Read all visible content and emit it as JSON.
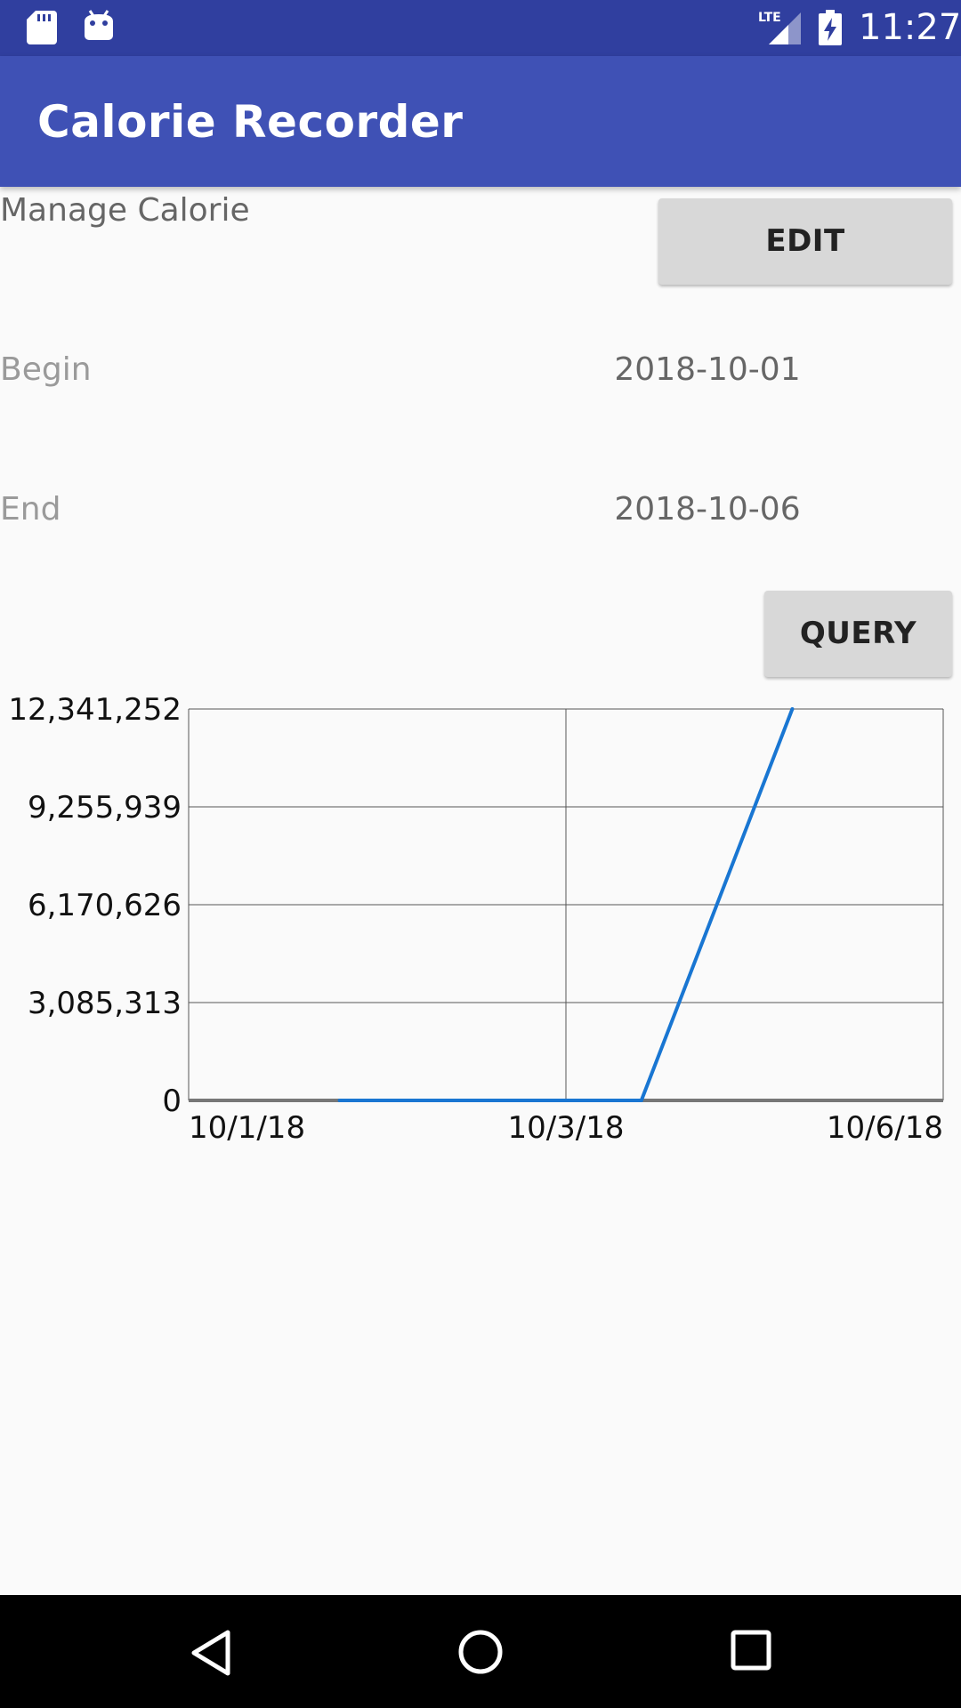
{
  "status_bar": {
    "time": "11:27",
    "network": "LTE",
    "icons": [
      "sd-card-icon",
      "android-icon",
      "lte-signal-icon",
      "battery-charging-icon"
    ]
  },
  "app_bar": {
    "title": "Calorie Recorder"
  },
  "manage": {
    "title": "Manage Calorie",
    "edit_label": "EDIT"
  },
  "filter": {
    "begin_label": "Begin",
    "begin_value": "2018-10-01",
    "end_label": "End",
    "end_value": "2018-10-06",
    "query_label": "QUERY"
  },
  "colors": {
    "status_bar": "#303f9f",
    "app_bar": "#3f51b5",
    "line": "#1976d2"
  },
  "chart_data": {
    "type": "line",
    "title": "",
    "xlabel": "",
    "ylabel": "",
    "x_ticks": [
      "10/1/18",
      "10/3/18",
      "10/6/18"
    ],
    "y_ticks": [
      "0",
      "3,085,313",
      "6,170,626",
      "9,255,939",
      "12,341,252"
    ],
    "xlim": [
      "2018-10-01",
      "2018-10-06"
    ],
    "ylim": [
      0,
      12341252
    ],
    "grid": true,
    "series": [
      {
        "x": [
          "2018-10-02",
          "2018-10-03",
          "2018-10-04",
          "2018-10-05"
        ],
        "y": [
          0,
          0,
          0,
          12341252
        ]
      }
    ]
  },
  "nav_bar": {
    "icons": [
      "back-icon",
      "home-icon",
      "recents-icon"
    ]
  }
}
